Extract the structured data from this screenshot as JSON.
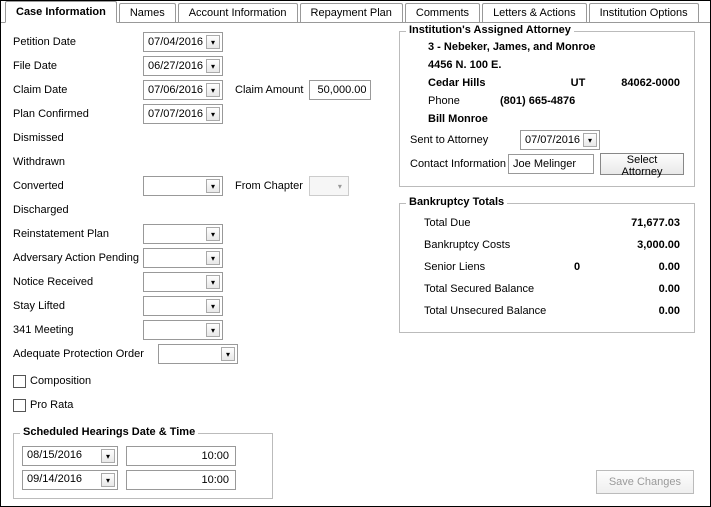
{
  "tabs": [
    "Case Information",
    "Names",
    "Account Information",
    "Repayment Plan",
    "Comments",
    "Letters & Actions",
    "Institution Options"
  ],
  "activeTab": 0,
  "left": {
    "petition": {
      "label": "Petition Date",
      "value": "07/04/2016"
    },
    "file": {
      "label": "File Date",
      "value": "06/27/2016"
    },
    "claim": {
      "label": "Claim Date",
      "value": "07/06/2016"
    },
    "claimAmountLabel": "Claim Amount",
    "claimAmount": "50,000.00",
    "plan": {
      "label": "Plan Confirmed",
      "value": "07/07/2016"
    },
    "dismissed": "Dismissed",
    "withdrawn": "Withdrawn",
    "converted": {
      "label": "Converted",
      "value": ""
    },
    "fromChapterLabel": "From Chapter",
    "discharged": "Discharged",
    "reinstatement": {
      "label": "Reinstatement Plan",
      "value": ""
    },
    "adversary": {
      "label": "Adversary Action Pending",
      "value": ""
    },
    "notice": {
      "label": "Notice Received",
      "value": ""
    },
    "stay": {
      "label": "Stay Lifted",
      "value": ""
    },
    "meeting": {
      "label": "341 Meeting",
      "value": ""
    },
    "adequate": {
      "label": "Adequate Protection Order",
      "value": ""
    },
    "composition": "Composition",
    "prorata": "Pro Rata"
  },
  "attorney": {
    "title": "Institution's Assigned Attorney",
    "name": "3 - Nebeker, James, and Monroe",
    "addr1": "4456 N. 100 E.",
    "city": "Cedar Hills",
    "state": "UT",
    "zip": "84062-0000",
    "phoneLabel": "Phone",
    "phone": "(801) 665-4876",
    "contactName": "Bill Monroe",
    "sentLabel": "Sent to Attorney",
    "sentDate": "07/07/2016",
    "contactInfoLabel": "Contact Information",
    "contactInfo": "Joe Melinger",
    "selectBtn": "Select Attorney"
  },
  "totals": {
    "title": "Bankruptcy Totals",
    "due": {
      "label": "Total Due",
      "value": "71,677.03"
    },
    "costs": {
      "label": "Bankruptcy Costs",
      "value": "3,000.00"
    },
    "liens": {
      "label": "Senior Liens",
      "mid": "0",
      "value": "0.00"
    },
    "secured": {
      "label": "Total Secured Balance",
      "value": "0.00"
    },
    "unsecured": {
      "label": "Total Unsecured Balance",
      "value": "0.00"
    }
  },
  "hearings": {
    "title": "Scheduled Hearings Date & Time",
    "rows": [
      {
        "date": "08/15/2016",
        "time": "10:00"
      },
      {
        "date": "09/14/2016",
        "time": "10:00"
      }
    ]
  },
  "saveBtn": "Save Changes"
}
